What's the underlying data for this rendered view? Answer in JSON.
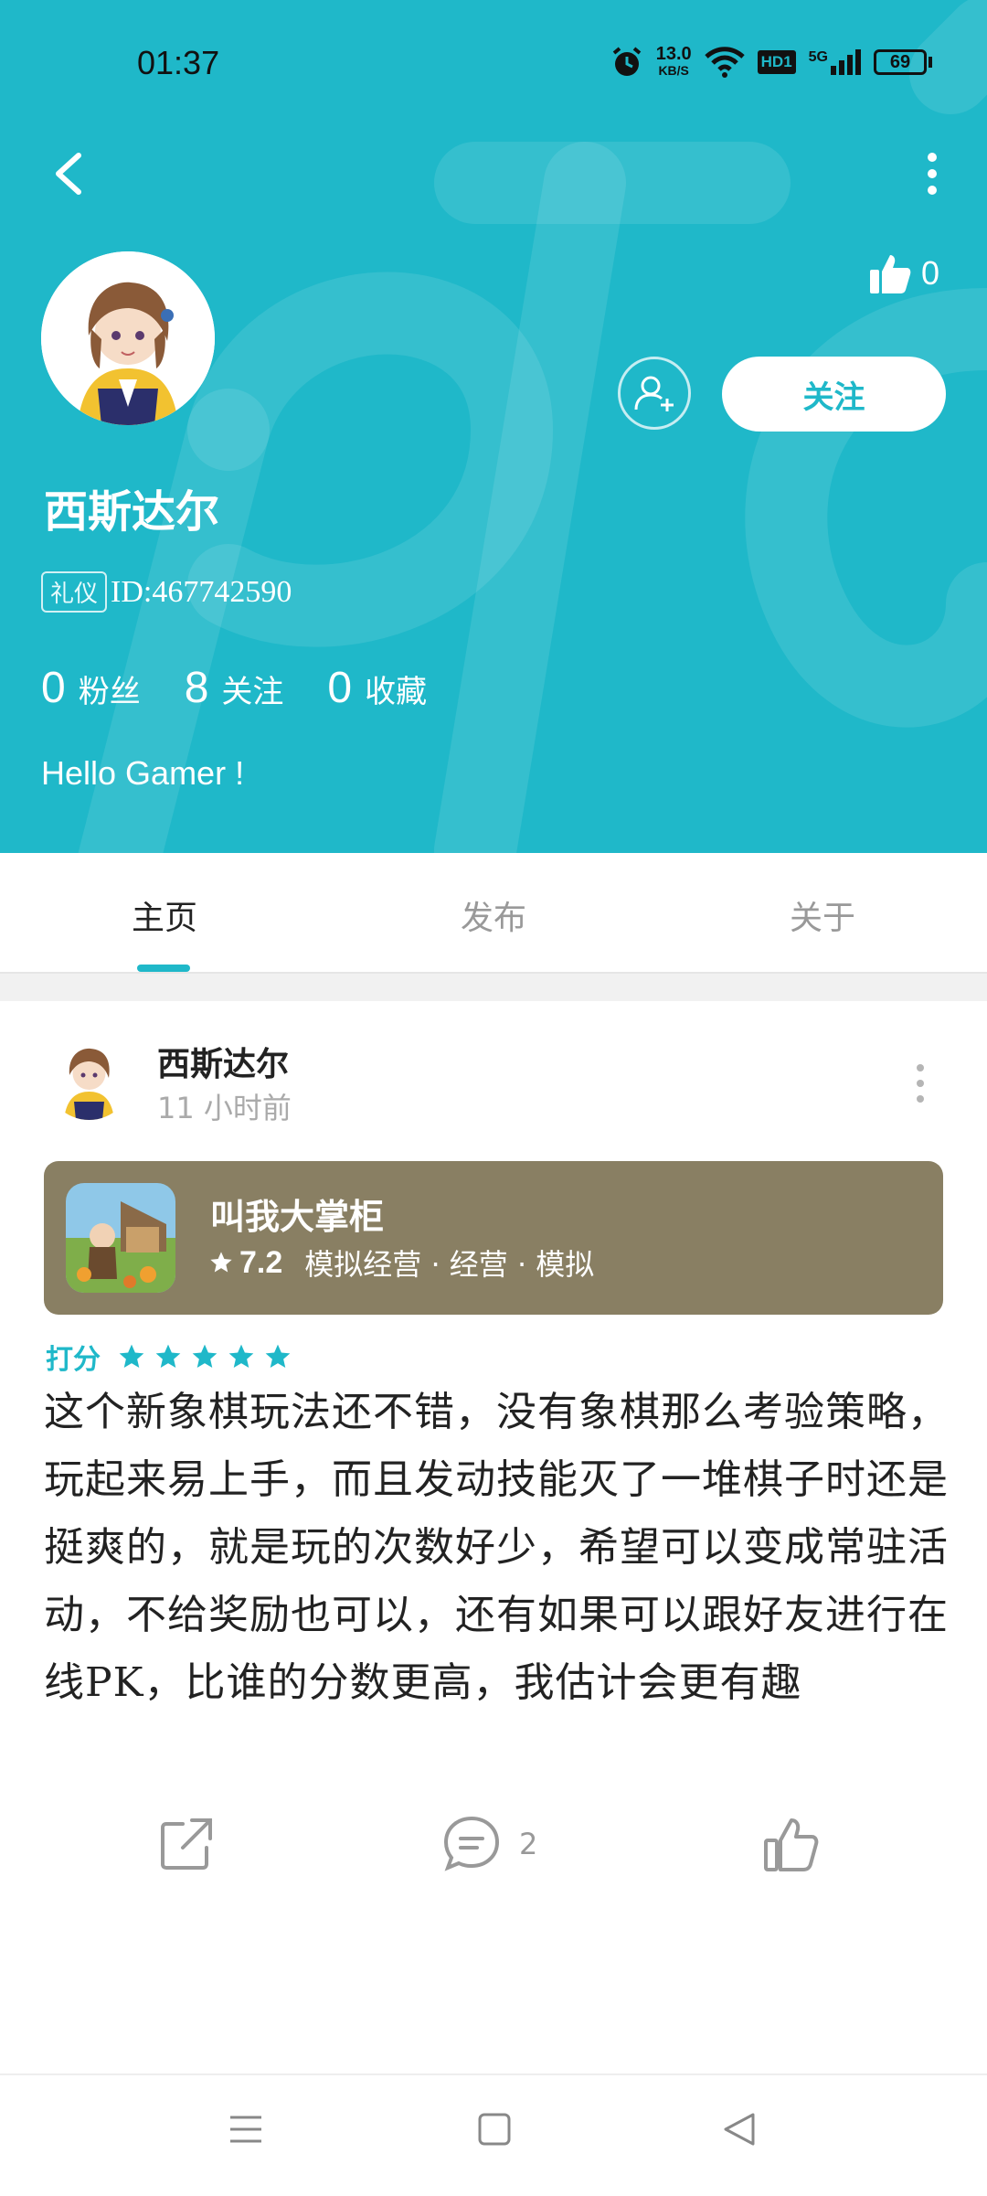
{
  "status_bar": {
    "time": "01:37",
    "net_speed_value": "13.0",
    "net_speed_unit": "KB/S",
    "hd_label": "HD1",
    "signal_label": "5G",
    "battery": "69",
    "icons": [
      "alarm-icon",
      "wifi-icon",
      "signal-icon",
      "battery-icon"
    ]
  },
  "profile": {
    "likes": "0",
    "follow_label": "关注",
    "name": "西斯达尔",
    "badge": "礼仪",
    "id_text": "ID:467742590",
    "bio": "Hello Gamer !",
    "stats": [
      {
        "num": "0",
        "label": "粉丝"
      },
      {
        "num": "8",
        "label": "关注"
      },
      {
        "num": "0",
        "label": "收藏"
      }
    ]
  },
  "tabs": [
    "主页",
    "发布",
    "关于"
  ],
  "active_tab": "主页",
  "post": {
    "author": "西斯达尔",
    "time": "11 小时前",
    "game": {
      "title": "叫我大掌柜",
      "score": "7.2",
      "tags": "模拟经营 · 经营 · 模拟"
    },
    "rating_label": "打分",
    "rating_stars": 5,
    "content": "这个新象棋玩法还不错，没有象棋那么考验策略，玩起来易上手，而且发动技能灭了一堆棋子时还是挺爽的，就是玩的次数好少，希望可以变成常驻活动，不给奖励也可以，还有如果可以跟好友进行在线PK，比谁的分数更高，我估计会更有趣",
    "comments": "2"
  },
  "colors": {
    "accent": "#1fb8c9",
    "card": "#897f63"
  }
}
